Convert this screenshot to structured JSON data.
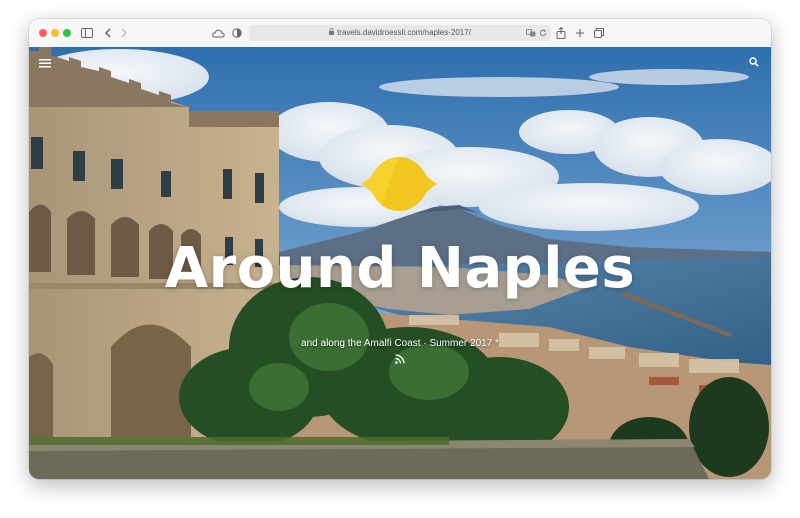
{
  "browser": {
    "url": "travels.davidroessli.com/naples-2017/",
    "icons": [
      "sidebar-icon",
      "back-icon",
      "forward-icon",
      "icloud-icon",
      "privacy-shield-icon",
      "lock-icon",
      "translate-icon",
      "reload-icon",
      "share-icon",
      "new-tab-icon",
      "tabs-icon"
    ]
  },
  "page": {
    "title": "Around Naples",
    "subtitle": "and along the Amalfi Coast · Summer 2017 *",
    "icons": [
      "menu-icon",
      "search-icon",
      "lemon-logo-icon",
      "rss-icon"
    ]
  },
  "colors": {
    "lemon": "#f7d12e",
    "sky": "#4a86c0",
    "sea": "#3d6f96"
  }
}
